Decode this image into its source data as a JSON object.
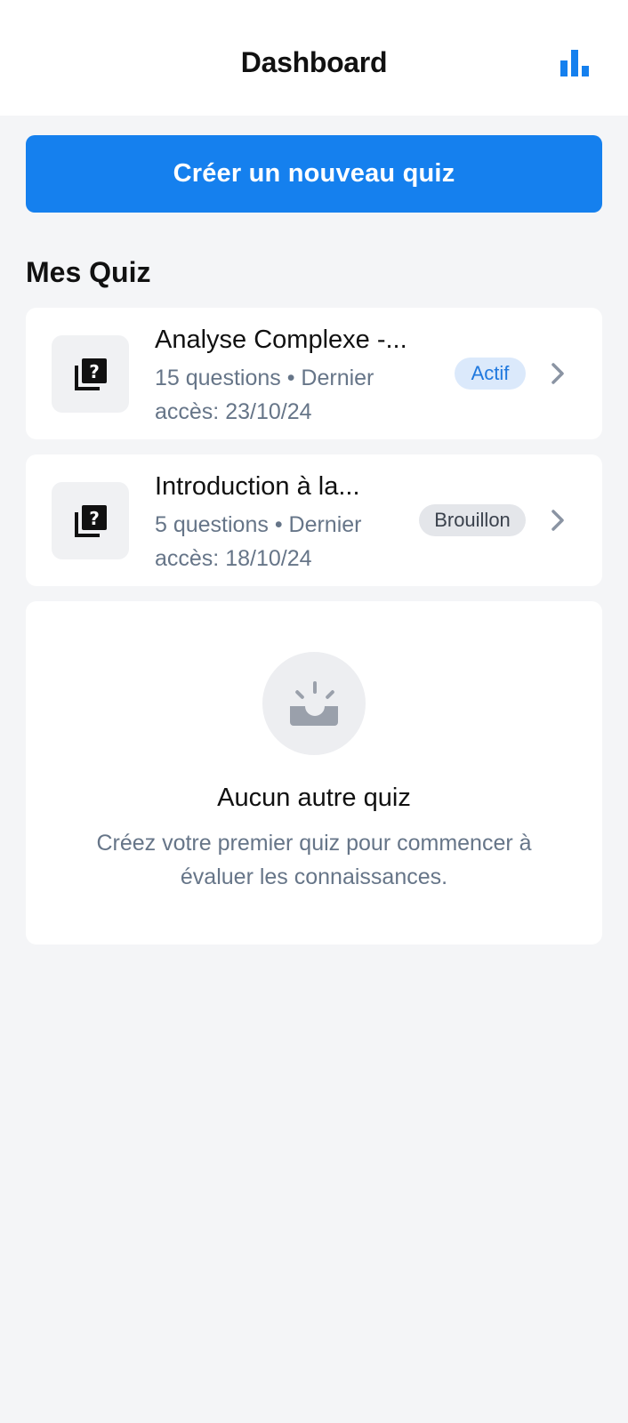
{
  "header": {
    "title": "Dashboard",
    "stats_icon": "bar-chart-icon",
    "accent_color": "#1580ee"
  },
  "actions": {
    "create_quiz_label": "Créer un nouveau quiz"
  },
  "section": {
    "title": "Mes Quiz"
  },
  "quizzes": [
    {
      "icon": "quiz-question-icon",
      "title": "Analyse Complexe -...",
      "meta": "15 questions • Dernier accès: 23/10/24",
      "status": "Actif",
      "status_color": "#1f78de"
    },
    {
      "icon": "quiz-question-icon",
      "title": "Introduction à la...",
      "meta": "5 questions • Dernier accès: 18/10/24",
      "status": "Brouillon",
      "status_color": "#3a414c"
    }
  ],
  "empty_state": {
    "icon": "empty-inbox-icon",
    "title": "Aucun autre quiz",
    "description": "Créez votre premier quiz pour commencer à évaluer les connaissances."
  }
}
